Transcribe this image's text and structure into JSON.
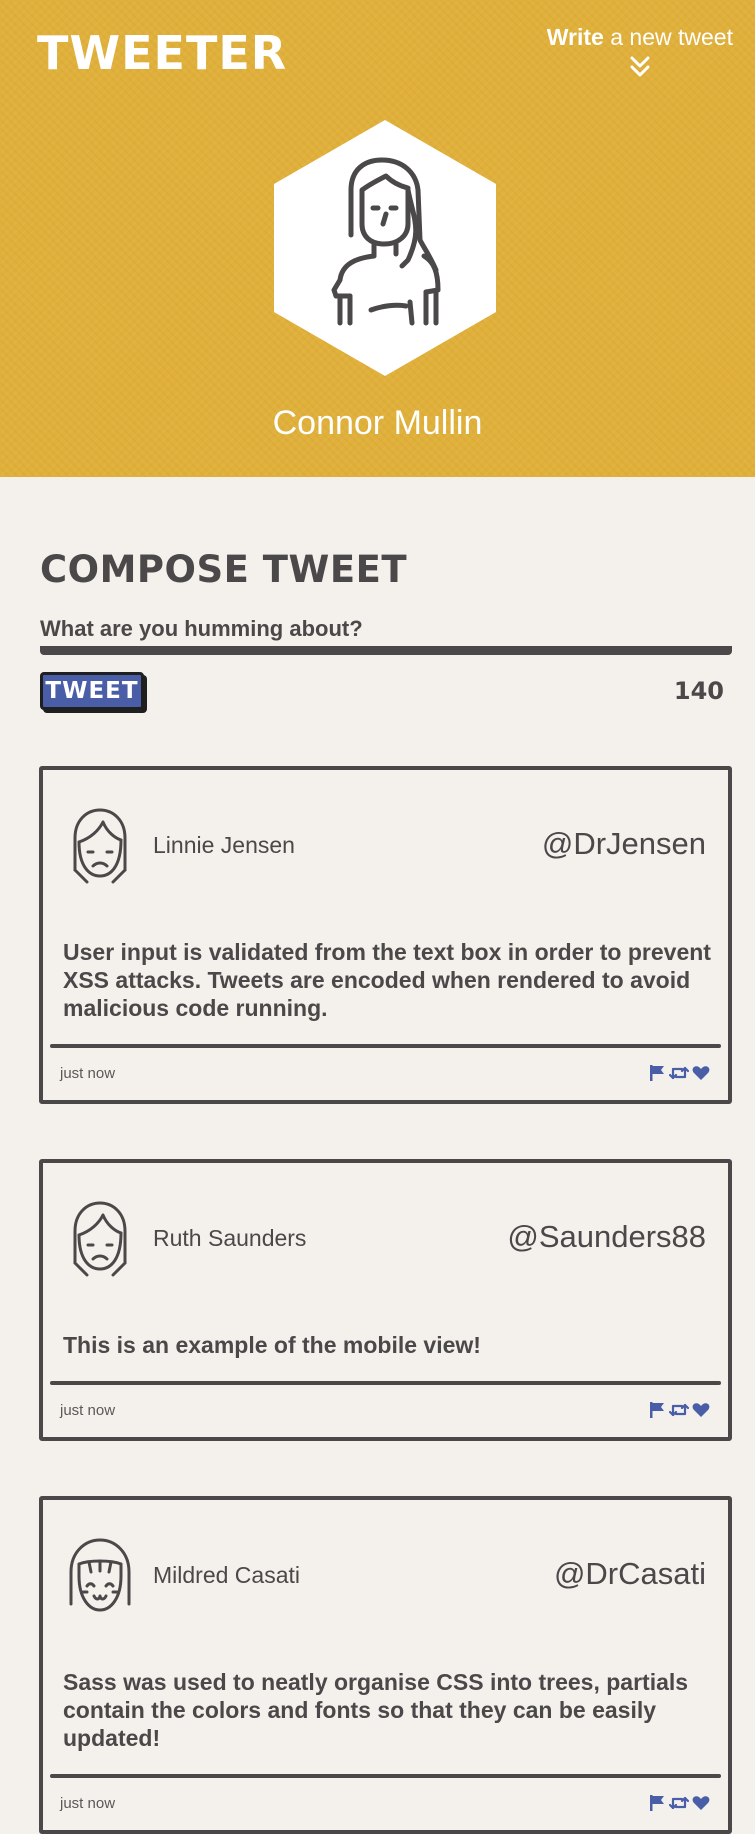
{
  "header": {
    "logo": "TWEETER",
    "write_bold": "Write",
    "write_rest": " a new tweet",
    "toggle_icon": "double-chevron-down-icon",
    "profile_avatar_icon": "woman-avatar-icon",
    "profile_name": "Connor Mullin"
  },
  "compose": {
    "title": "COMPOSE TWEET",
    "placeholder": "What are you humming about?",
    "button_label": "TWEET",
    "counter": "140"
  },
  "tweets": [
    {
      "name": "Linnie Jensen",
      "handle": "@DrJensen",
      "avatar": "sad-girl-avatar-icon",
      "text": "User input is validated from the text box in order to prevent XSS attacks. Tweets are encoded when rendered to avoid malicious code running.",
      "time": "just now"
    },
    {
      "name": "Ruth Saunders",
      "handle": "@Saunders88",
      "avatar": "sad-girl-avatar-icon",
      "text": "This is an example of the mobile view!",
      "time": "just now"
    },
    {
      "name": "Mildred Casati",
      "handle": "@DrCasati",
      "avatar": "smiling-girl-avatar-icon",
      "text": "Sass was used to neatly organise CSS into trees, partials contain the colors and fonts so that they can be easily updated!",
      "time": "just now"
    }
  ],
  "colors": {
    "header_bg": "#e0b03a",
    "page_bg": "#f4f1ed",
    "text_dark": "#4a4848",
    "accent_blue": "#4a5ea8"
  }
}
